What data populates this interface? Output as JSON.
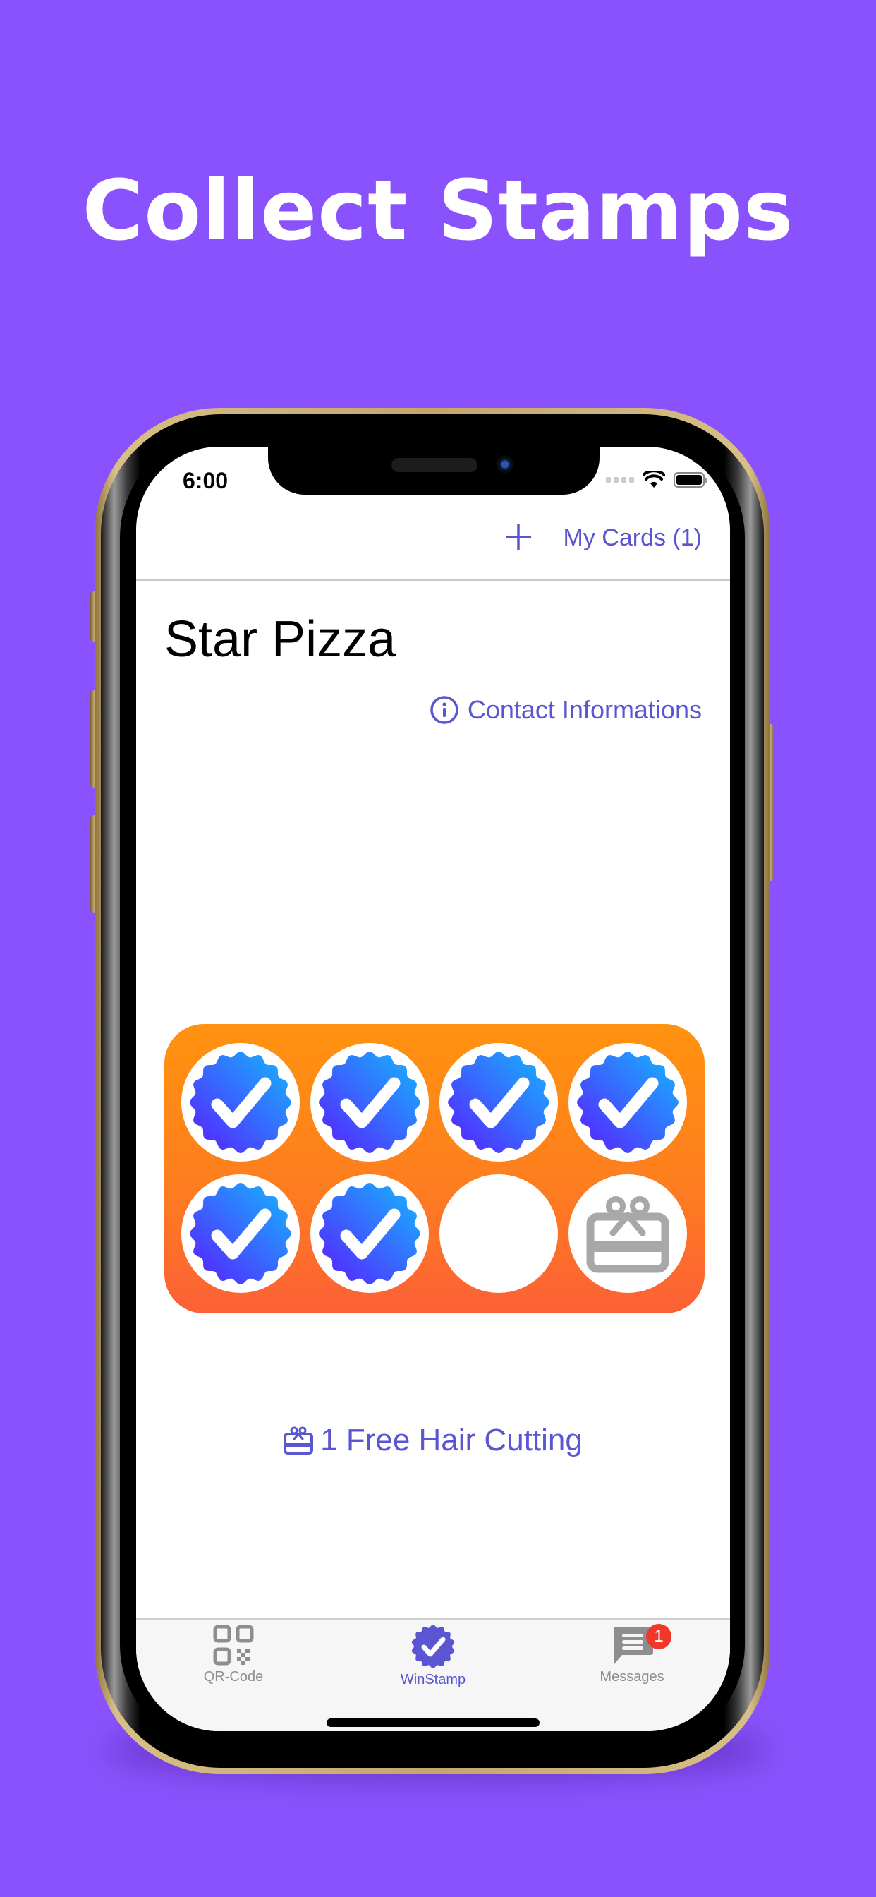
{
  "promo": {
    "headline": "Collect Stamps"
  },
  "status_bar": {
    "time": "6:00"
  },
  "nav": {
    "add_icon": "plus-icon",
    "my_cards_label": "My Cards (1)"
  },
  "store": {
    "name": "Star Pizza",
    "contact_label": "Contact Informations",
    "contact_icon": "info-circle-icon"
  },
  "stamp_card": {
    "total_slots": 8,
    "stamps_collected": 6,
    "slots": [
      {
        "state": "stamped",
        "icon": "verified-badge-icon"
      },
      {
        "state": "stamped",
        "icon": "verified-badge-icon"
      },
      {
        "state": "stamped",
        "icon": "verified-badge-icon"
      },
      {
        "state": "stamped",
        "icon": "verified-badge-icon"
      },
      {
        "state": "stamped",
        "icon": "verified-badge-icon"
      },
      {
        "state": "stamped",
        "icon": "verified-badge-icon"
      },
      {
        "state": "empty",
        "icon": null
      },
      {
        "state": "reward",
        "icon": "gift-card-icon"
      }
    ],
    "colors": {
      "card_top": "#ff930f",
      "card_bottom": "#fc6036",
      "stamp_start": "#5a1cff",
      "stamp_end": "#14b8ff"
    }
  },
  "reward": {
    "icon": "gift-card-icon",
    "label": "1 Free Hair Cutting"
  },
  "tabbar": {
    "tabs": [
      {
        "label": "QR-Code",
        "icon": "qr-code-icon",
        "active": false
      },
      {
        "label": "WinStamp",
        "icon": "verified-badge-icon",
        "active": true
      },
      {
        "label": "Messages",
        "icon": "message-icon",
        "active": false,
        "badge": "1"
      }
    ]
  },
  "colors": {
    "background": "#8a52fc",
    "accent": "#5a55d1",
    "inactive": "#8e8e8e",
    "badge": "#f2362a"
  }
}
